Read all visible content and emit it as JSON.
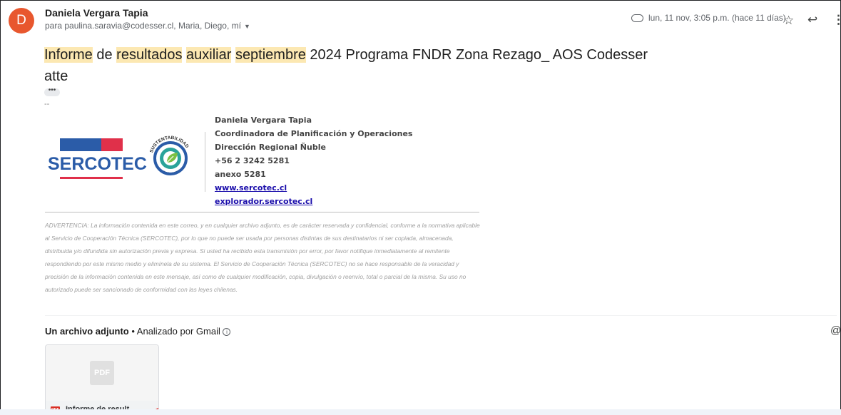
{
  "email": {
    "avatar_letter": "D",
    "sender_name": "Daniela Vergara Tapia",
    "recipients": "para paulina.saravia@codesser.cl, Maria, Diego, mí",
    "date": "lun, 11 nov, 3:05 p.m. (hace 11 días)",
    "subject_parts": [
      "Informe",
      " de ",
      "resultados",
      " ",
      "auxiliar",
      " ",
      "septiembre",
      " 2024 Programa FNDR Zona Rezago_ AOS Codesser"
    ],
    "body_line": "atte",
    "trimmed_dots": "•••",
    "sig_separator": "--"
  },
  "signature": {
    "logo_text": "SERCOTEC",
    "seal_top_text": "SUSTENTABILIDAD",
    "seal_bottom_text": "SERCOTEC",
    "name": "Daniela Vergara Tapia",
    "role": "Coordinadora de Planificación y Operaciones",
    "office": "Dirección Regional Ñuble",
    "phone": "+56 2 3242 5281",
    "extension": "anexo 5281",
    "link1": "www.sercotec.cl",
    "link2": "explorador.sercotec.cl"
  },
  "disclaimer": "ADVERTENCIA: La información contenida en este correo, y en cualquier archivo adjunto, es de carácter reservada y confidencial, conforme a la normativa aplicable al Servicio de Cooperación Técnica (SERCOTEC), por lo que no puede ser usada por personas distintas de sus destinatarios ni ser copiada, almacenada, distribuida y/o difundida sin autorización previa y expresa. Si usted ha recibido esta transmisión por error, por favor notifique inmediatamente al remitente respondiendo por este mismo medio y elimínela de su sistema. El Servicio de Cooperación Técnica (SERCOTEC) no se hace responsable de la veracidad y precisión de la información contenida en este mensaje, así como de cualquier modificación, copia, divulgación o reenvío, total o parcial de la misma. Su uso no autorizado puede ser sancionado de conformidad con las leyes chilenas.",
  "attachments": {
    "heading": "Un archivo adjunto",
    "scanned": " • Analizado por Gmail ",
    "file_badge": "PDF",
    "file_name": "Informe de result..."
  },
  "icons": {
    "attachment": "paperclip-icon",
    "star": "star-icon",
    "reply": "reply-icon",
    "more": "more-vert-icon",
    "drive": "add-to-drive-icon"
  }
}
